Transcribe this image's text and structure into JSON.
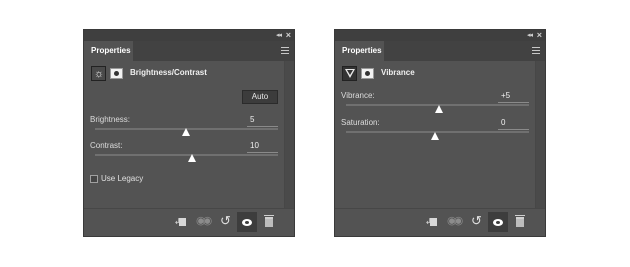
{
  "panels": [
    {
      "tab_label": "Properties",
      "adjustment_title": "Brightness/Contrast",
      "adjustment_icon": "brightness-contrast-icon",
      "auto_label": "Auto",
      "params": [
        {
          "label": "Brightness:",
          "value": "5"
        },
        {
          "label": "Contrast:",
          "value": "10"
        }
      ],
      "use_legacy_label": "Use Legacy",
      "use_legacy_checked": false
    },
    {
      "tab_label": "Properties",
      "adjustment_title": "Vibrance",
      "adjustment_icon": "vibrance-icon",
      "params": [
        {
          "label": "Vibrance:",
          "value": "+5"
        },
        {
          "label": "Saturation:",
          "value": "0"
        }
      ]
    }
  ],
  "footer_icons": [
    "clip-to-layer-icon",
    "view-previous-state-icon",
    "reset-icon",
    "toggle-visibility-icon",
    "delete-icon"
  ],
  "colors": {
    "panel_bg": "#535353",
    "tab_bar_bg": "#424242",
    "text": "#e0e0e0",
    "thumb": "#ffffff"
  }
}
